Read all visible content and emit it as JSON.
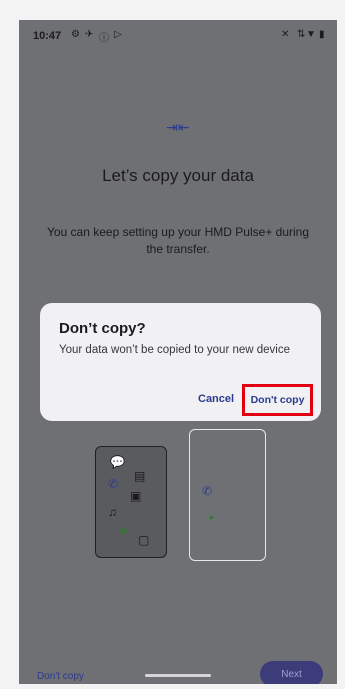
{
  "status_bar": {
    "time": "10:47",
    "icons": [
      "settings-icon",
      "airplane-icon",
      "info-icon",
      "play-icon",
      "vibrate-off-icon",
      "data-arrows-icon",
      "wifi-icon",
      "battery-icon"
    ]
  },
  "page": {
    "title": "Let’s copy your data",
    "subtitle": "You can keep setting up your HMD Pulse+ during the transfer.",
    "copy_icon": "copy-arrows-icon",
    "bottom": {
      "dont_copy_label": "Don't copy",
      "next_label": "Next"
    }
  },
  "dialog": {
    "title": "Don’t copy?",
    "body": "Your data won’t be copied to your new device",
    "cancel_label": "Cancel",
    "confirm_label": "Don't copy"
  },
  "colors": {
    "accent": "#2b3a8f",
    "highlight_box": "#e0000f",
    "scrim": "#6f7074",
    "dialog_bg": "#f1f1f4",
    "next_button": "#3b3c79"
  }
}
